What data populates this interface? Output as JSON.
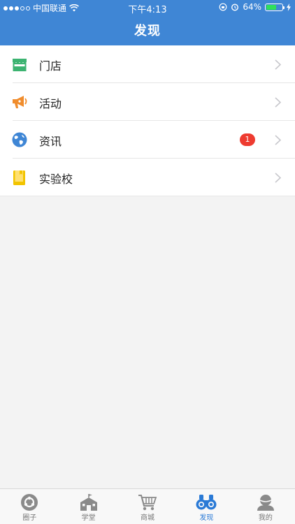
{
  "status_bar": {
    "carrier": "中国联通",
    "time": "下午4:13",
    "battery": "64%",
    "battery_level": 0.64
  },
  "header": {
    "title": "发现"
  },
  "menu": {
    "items": [
      {
        "label": "门店",
        "icon": "store-icon",
        "color": "#3cb371"
      },
      {
        "label": "活动",
        "icon": "megaphone-icon",
        "color": "#f08c2c"
      },
      {
        "label": "资讯",
        "icon": "globe-icon",
        "color": "#3f86d5",
        "badge": "1"
      },
      {
        "label": "实验校",
        "icon": "book-icon",
        "color": "#f2c400"
      }
    ]
  },
  "tabbar": {
    "active": "发现",
    "active_color": "#2a7ad6",
    "items": [
      {
        "label": "圈子",
        "icon": "circle-icon"
      },
      {
        "label": "学堂",
        "icon": "school-icon"
      },
      {
        "label": "商城",
        "icon": "cart-icon"
      },
      {
        "label": "发现",
        "icon": "binoculars-icon"
      },
      {
        "label": "我的",
        "icon": "profile-icon"
      }
    ]
  }
}
